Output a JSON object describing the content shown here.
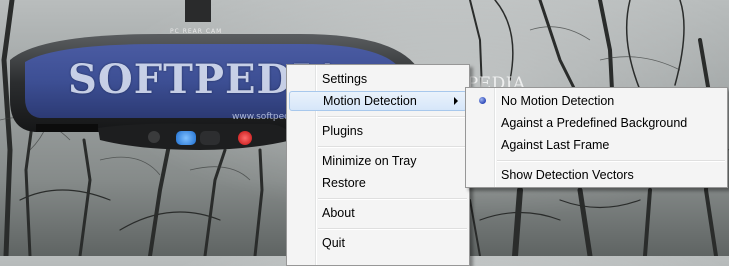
{
  "app": {
    "camera_label": "PC REAR CAM",
    "camera_watermark": "SOFTPEDIA",
    "camera_watermark_url": "www.softpedia.com",
    "background_watermark": "SOFTPEDIA"
  },
  "context_menu": {
    "items": [
      {
        "label": "Settings"
      },
      {
        "label": "Motion Detection"
      },
      {
        "label": "Plugins"
      },
      {
        "label": "Minimize on Tray"
      },
      {
        "label": "Restore"
      },
      {
        "label": "About"
      },
      {
        "label": "Quit"
      }
    ]
  },
  "submenu": {
    "selected": "No Motion Detection",
    "items": [
      {
        "label": "No Motion Detection"
      },
      {
        "label": "Against a Predefined Background"
      },
      {
        "label": "Against Last Frame"
      },
      {
        "label": "Show Detection Vectors"
      }
    ]
  },
  "colors": {
    "menu_background": "#f4f4f4",
    "highlight": "#d6e6f9",
    "camera_screen": "#3d4f94",
    "record_button": "#e02020",
    "active_button": "#2a7fe0"
  }
}
